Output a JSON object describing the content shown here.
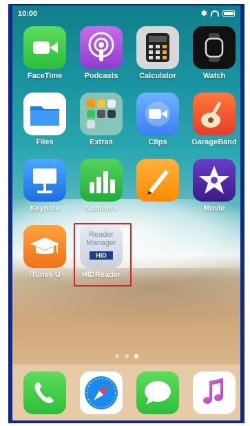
{
  "status_bar": {
    "time": "10:00"
  },
  "apps": [
    {
      "id": "facetime",
      "label": "FaceTime"
    },
    {
      "id": "podcasts",
      "label": "Podcasts"
    },
    {
      "id": "calculator",
      "label": "Calculator"
    },
    {
      "id": "watch",
      "label": "Watch"
    },
    {
      "id": "files",
      "label": "Files"
    },
    {
      "id": "extras",
      "label": "Extras"
    },
    {
      "id": "clips",
      "label": "Clips"
    },
    {
      "id": "garageband",
      "label": "GarageBand"
    },
    {
      "id": "keynote",
      "label": "Keynote"
    },
    {
      "id": "numbers",
      "label": "Numbers"
    },
    {
      "id": "pages",
      "label": ""
    },
    {
      "id": "movie",
      "label": "Movie"
    },
    {
      "id": "itunesu",
      "label": "iTunes U"
    },
    {
      "id": "hidreader",
      "label": "HIDReader",
      "icon_text_1": "Reader",
      "icon_text_2": "Manager",
      "icon_text_3": "HID"
    }
  ],
  "page_dots": {
    "count": 3,
    "active": 3
  },
  "dock": [
    {
      "id": "phone",
      "label": ""
    },
    {
      "id": "safari",
      "label": ""
    },
    {
      "id": "messages",
      "label": ""
    },
    {
      "id": "music",
      "label": ""
    }
  ],
  "colors": {
    "highlight": "#e02020",
    "frame": "#0d2a8a"
  }
}
